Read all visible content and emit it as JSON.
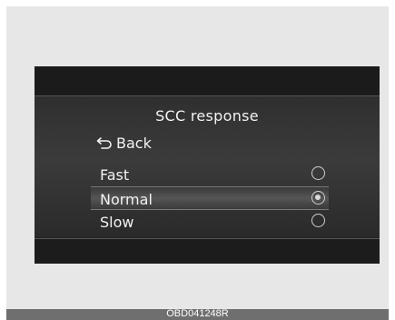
{
  "screen": {
    "title": "SCC response",
    "back_label": "Back",
    "options": [
      {
        "label": "Fast",
        "selected": false
      },
      {
        "label": "Normal",
        "selected": true
      },
      {
        "label": "Slow",
        "selected": false
      }
    ]
  },
  "caption": "OBD041248R",
  "icons": {
    "back": "back-arrow-icon",
    "radio": "radio-button-icon"
  }
}
